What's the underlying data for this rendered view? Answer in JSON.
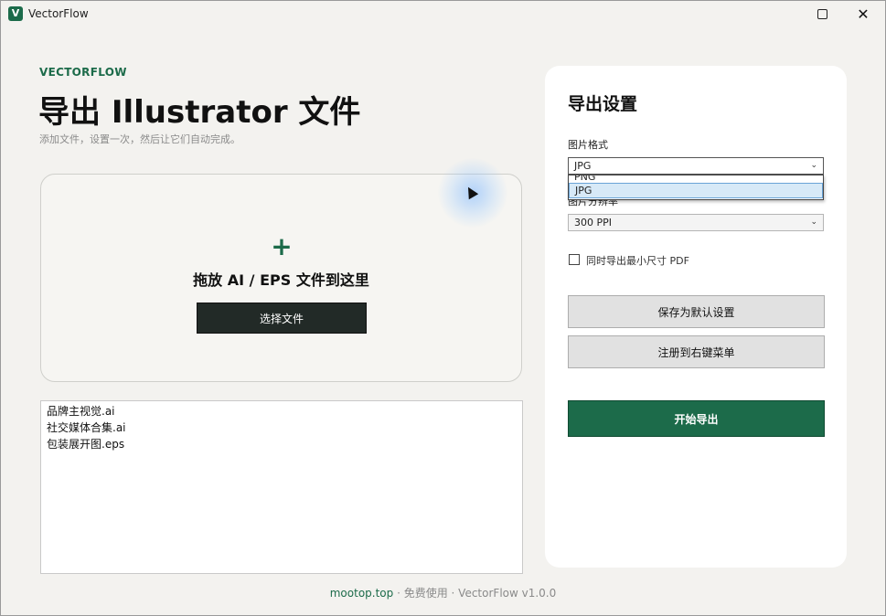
{
  "window": {
    "app_icon": "V",
    "title": "VectorFlow",
    "maximize_icon": "maximize-icon",
    "close_icon": "✕"
  },
  "main": {
    "brand": "VECTORFLOW",
    "heading": "导出 Illustrator 文件",
    "subtitle": "添加文件，设置一次，然后让它们自动完成。",
    "dropzone": {
      "plus": "+",
      "label": "拖放 AI / EPS 文件到这里",
      "choose_button": "选择文件"
    },
    "files": [
      "品牌主视觉.ai",
      "社交媒体合集.ai",
      "包装展开图.eps"
    ]
  },
  "panel": {
    "title": "导出设置",
    "format_label": "图片格式",
    "format_value": "JPG",
    "format_options": [
      "PNG",
      "JPG"
    ],
    "resolution_label": "图片分辨率",
    "resolution_value": "300 PPI",
    "pdf_checkbox_label": "同时导出最小尺寸 PDF",
    "pdf_checked": false,
    "save_default_button": "保存为默认设置",
    "register_menu_button": "注册到右键菜单",
    "start_button": "开始导出"
  },
  "footer": {
    "link": "mootop.top",
    "sep1": " · ",
    "free": "免费使用",
    "sep2": " · ",
    "version": "VectorFlow v1.0.0"
  },
  "colors": {
    "accent": "#1c6b4a",
    "dark_button": "#222a27",
    "background": "#f3f2ef"
  }
}
